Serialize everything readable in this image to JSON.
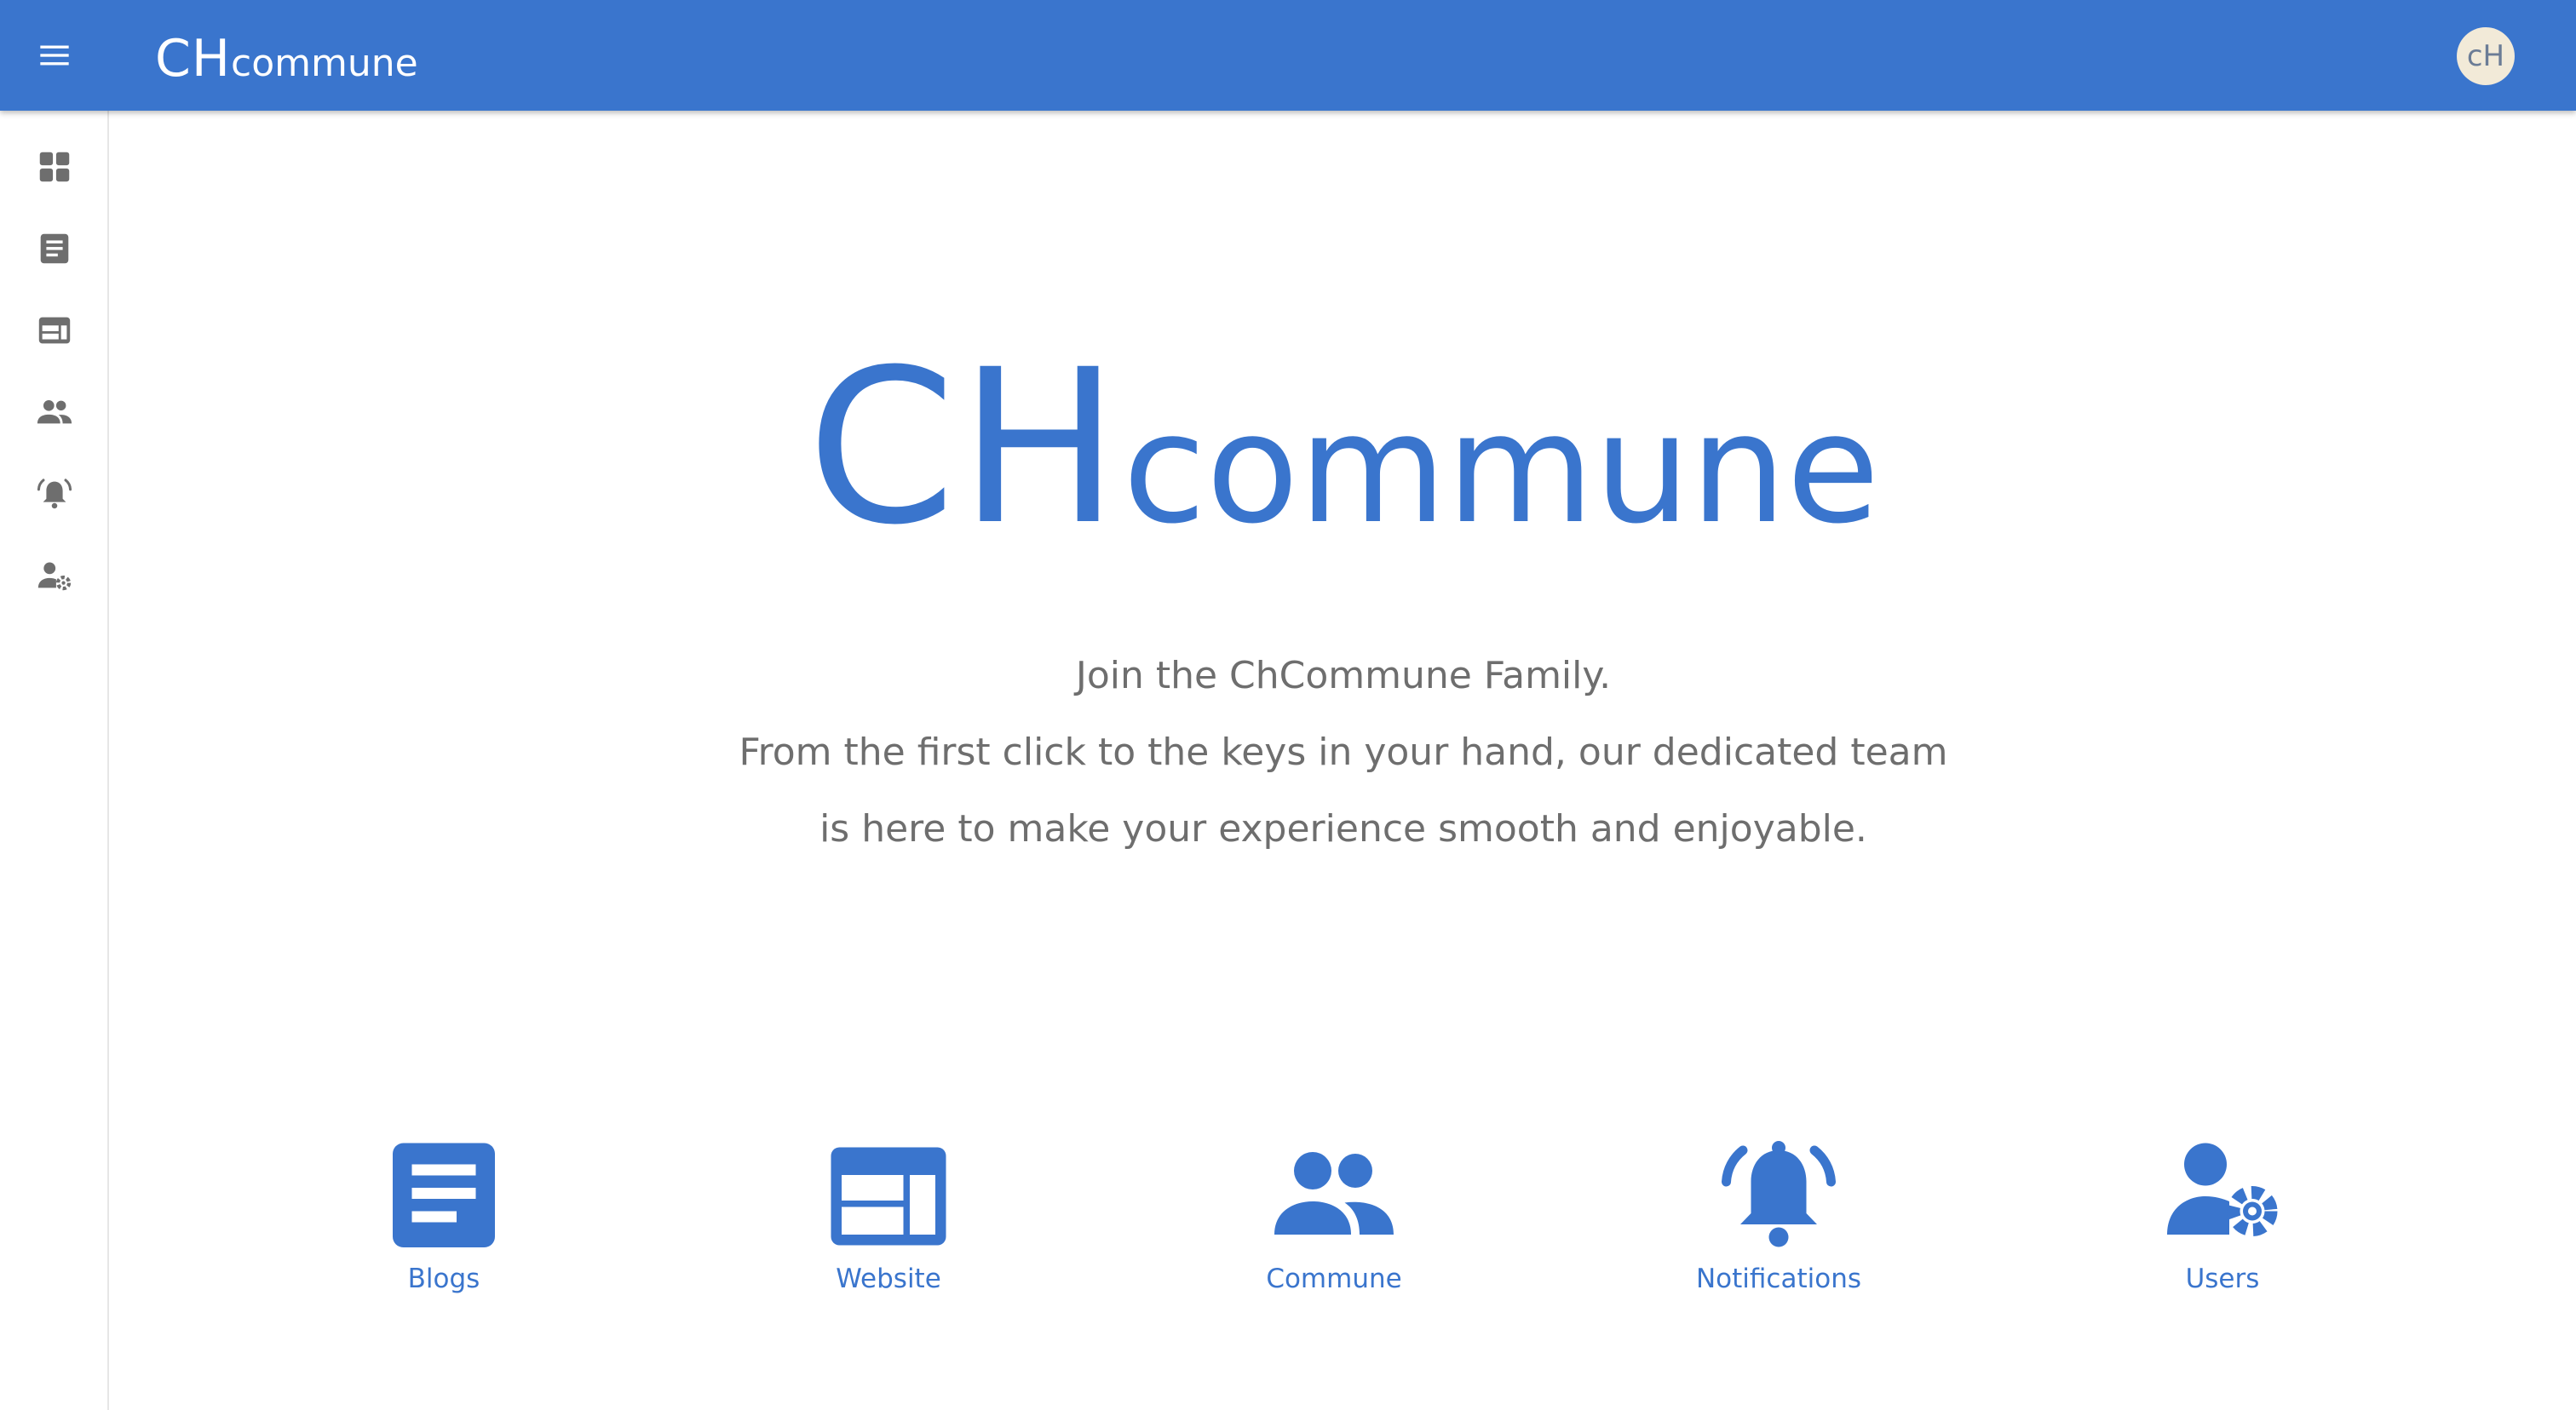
{
  "header": {
    "brand_big": "CH",
    "brand_small": "commune",
    "avatar_text": "cH"
  },
  "sidebar": {
    "items": [
      {
        "name": "dashboard",
        "icon": "dashboard-icon"
      },
      {
        "name": "blogs",
        "icon": "article-icon"
      },
      {
        "name": "website",
        "icon": "web-icon"
      },
      {
        "name": "commune",
        "icon": "people-icon"
      },
      {
        "name": "notifications",
        "icon": "alarm-bell-icon"
      },
      {
        "name": "users",
        "icon": "manage-accounts-icon"
      }
    ]
  },
  "hero": {
    "logo_big": "CH",
    "logo_small": "commune",
    "lines": [
      "Join the ChCommune Family.",
      "From the first click to the keys in your hand, our dedicated team",
      "is here to make your experience smooth and enjoyable."
    ]
  },
  "features": [
    {
      "label": "Blogs",
      "icon": "article-icon"
    },
    {
      "label": "Website",
      "icon": "web-icon"
    },
    {
      "label": "Commune",
      "icon": "people-icon"
    },
    {
      "label": "Notifications",
      "icon": "alarm-bell-icon"
    },
    {
      "label": "Users",
      "icon": "manage-accounts-icon"
    }
  ],
  "colors": {
    "primary": "#3a75cd",
    "icon_gray": "#6e6e6e",
    "text_gray": "#6e6e6e",
    "avatar_bg": "#f2ead8"
  }
}
